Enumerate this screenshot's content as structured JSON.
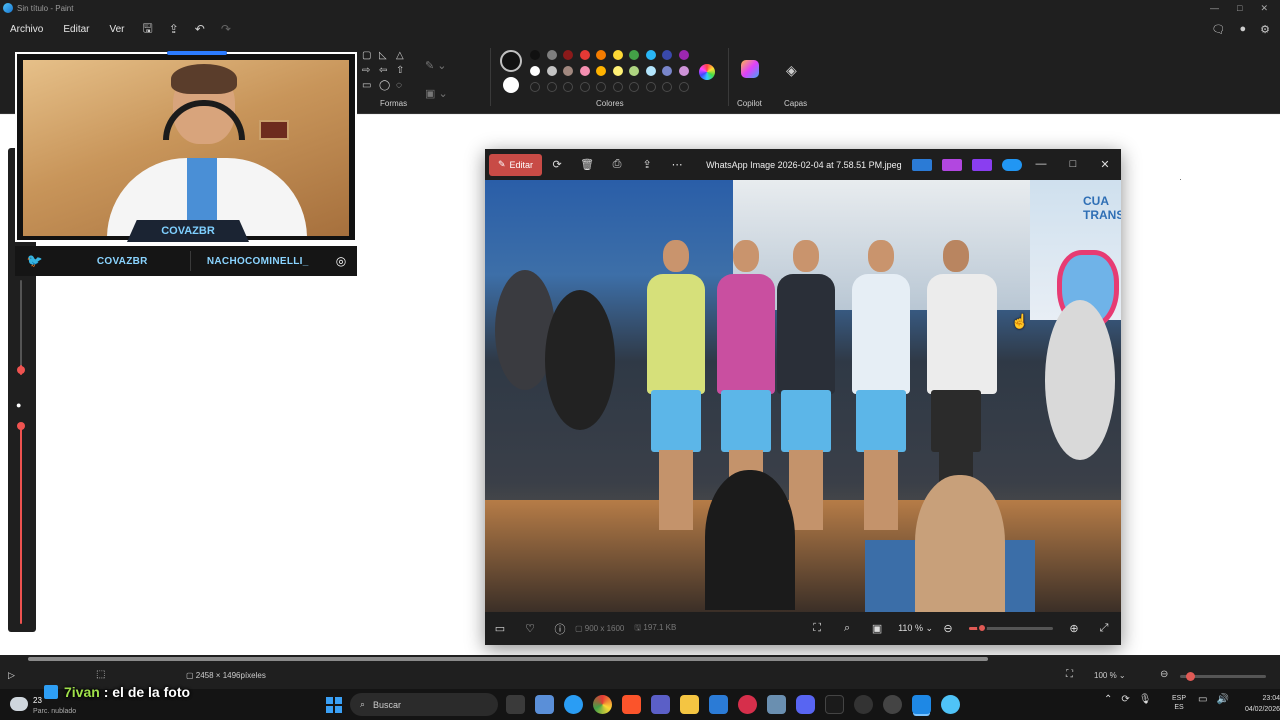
{
  "window": {
    "title": "Sin título - Paint"
  },
  "menu": [
    "Archivo",
    "Editar",
    "Ver"
  ],
  "ribbon": {
    "shapes_label": "Formas",
    "colors_label": "Colores",
    "copilot_label": "Copilot",
    "layers_label": "Capas",
    "palette_row1": [
      "#111111",
      "#7f7f7f",
      "#8b1a1a",
      "#e53935",
      "#f57c00",
      "#fdd835",
      "#43a047",
      "#29b6f6",
      "#3949ab",
      "#9c27b0"
    ],
    "palette_row2": [
      "#ffffff",
      "#c3c3c3",
      "#a1887f",
      "#f48fb1",
      "#ffb300",
      "#fff176",
      "#aed581",
      "#b3e5fc",
      "#7986cb",
      "#ce93d8"
    ]
  },
  "overlay": {
    "cam_name": "COVAZBR",
    "social_twitter": "COVAZBR",
    "social_instagram": "NACHOCOMINELLI_"
  },
  "viewer": {
    "edit_label": "Editar",
    "file_title": "WhatsApp Image 2026-02-04 at 7.58.51 PM.jpeg",
    "dimensions": "900 x 1600",
    "file_size": "197.1 KB",
    "zoom": "110 %",
    "zoom_level": 0.15,
    "photo_banner": "CUA\nTRANS"
  },
  "statusbar": {
    "canvas_size": "2458 × 1496píxeles",
    "zoom": "100 %"
  },
  "chat": {
    "user": "7ivan",
    "message": " : el de la foto"
  },
  "taskbar": {
    "weather_temp": "23",
    "weather_desc": "Parc. nublado",
    "search_placeholder": "Buscar",
    "lang_1": "ESP",
    "lang_2": "ES",
    "time": "23:04",
    "date": "04/02/2026"
  }
}
